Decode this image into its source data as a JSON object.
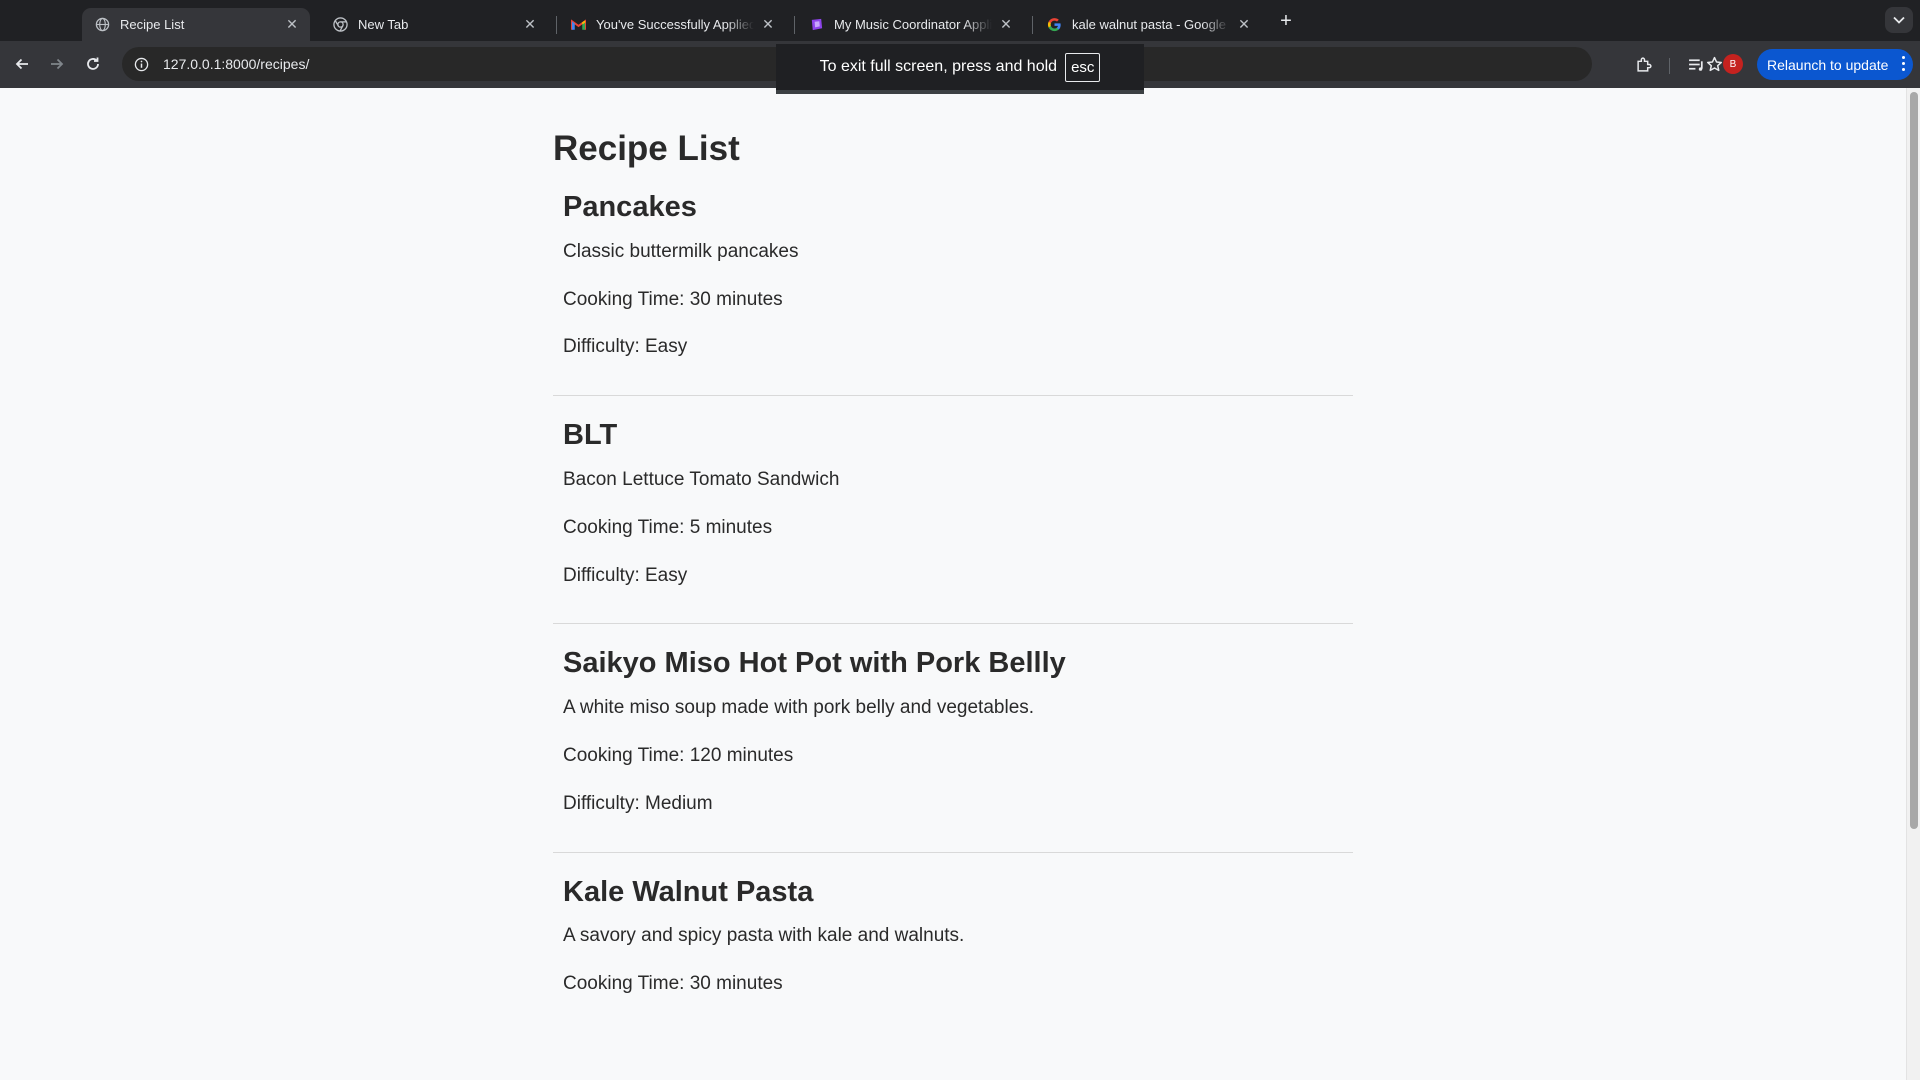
{
  "browser": {
    "tabs": [
      {
        "title": "Recipe List",
        "icon": "globe-icon",
        "active": true
      },
      {
        "title": "New Tab",
        "icon": "chrome-icon",
        "active": false
      },
      {
        "title": "You've Successfully Applied t",
        "icon": "gmail-icon",
        "active": false
      },
      {
        "title": "My Music Coordinator Applica",
        "icon": "app-logo-icon",
        "active": false
      },
      {
        "title": "kale walnut pasta - Google Se",
        "icon": "google-icon",
        "active": false
      }
    ],
    "url": "127.0.0.1:8000/recipes/",
    "profile_initial": "B",
    "relaunch_label": "Relaunch to update",
    "fullscreen_toast": {
      "message": "To exit full screen, press and hold",
      "key": "esc"
    }
  },
  "page": {
    "title": "Recipe List",
    "recipes": [
      {
        "name": "Pancakes",
        "description": "Classic buttermilk pancakes",
        "cooking_time": "Cooking Time: 30 minutes",
        "difficulty": "Difficulty: Easy"
      },
      {
        "name": "BLT",
        "description": "Bacon Lettuce Tomato Sandwich",
        "cooking_time": "Cooking Time: 5 minutes",
        "difficulty": "Difficulty: Easy"
      },
      {
        "name": "Saikyo Miso Hot Pot with Pork Bellly",
        "description": "A white miso soup made with pork belly and vegetables.",
        "cooking_time": "Cooking Time: 120 minutes",
        "difficulty": "Difficulty: Medium"
      },
      {
        "name": "Kale Walnut Pasta",
        "description": "A savory and spicy pasta with kale and walnuts.",
        "cooking_time": "Cooking Time: 30 minutes",
        "difficulty": ""
      }
    ]
  }
}
